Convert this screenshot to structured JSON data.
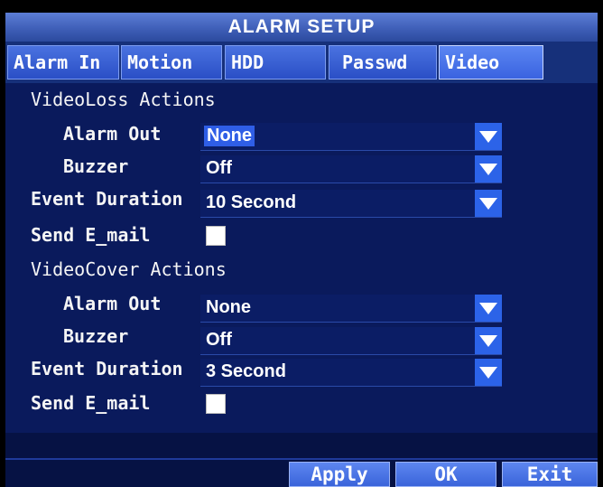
{
  "title": "ALARM SETUP",
  "tabs": [
    {
      "label": "Alarm In"
    },
    {
      "label": "Motion"
    },
    {
      "label": "HDD"
    },
    {
      "label": "Passwd"
    },
    {
      "label": "Video",
      "active": true
    }
  ],
  "video_loss": {
    "heading": "VideoLoss Actions",
    "alarm_out_label": "Alarm Out",
    "alarm_out_value": "None",
    "buzzer_label": "Buzzer",
    "buzzer_value": "Off",
    "duration_label": "Event Duration",
    "duration_value": "10 Second",
    "email_label": "Send E_mail",
    "email_checked": false
  },
  "video_cover": {
    "heading": "VideoCover Actions",
    "alarm_out_label": "Alarm Out",
    "alarm_out_value": "None",
    "buzzer_label": "Buzzer",
    "buzzer_value": "Off",
    "duration_label": "Event Duration",
    "duration_value": "3 Second",
    "email_label": "Send E_mail",
    "email_checked": false
  },
  "buttons": {
    "apply": "Apply",
    "ok": "OK",
    "exit": "Exit"
  },
  "colors": {
    "title_bar": "#4a6cc8",
    "panel_background": "#0a1a5c",
    "tab": "#3a63e0",
    "dropdown_arrow": "#2c63e8"
  }
}
